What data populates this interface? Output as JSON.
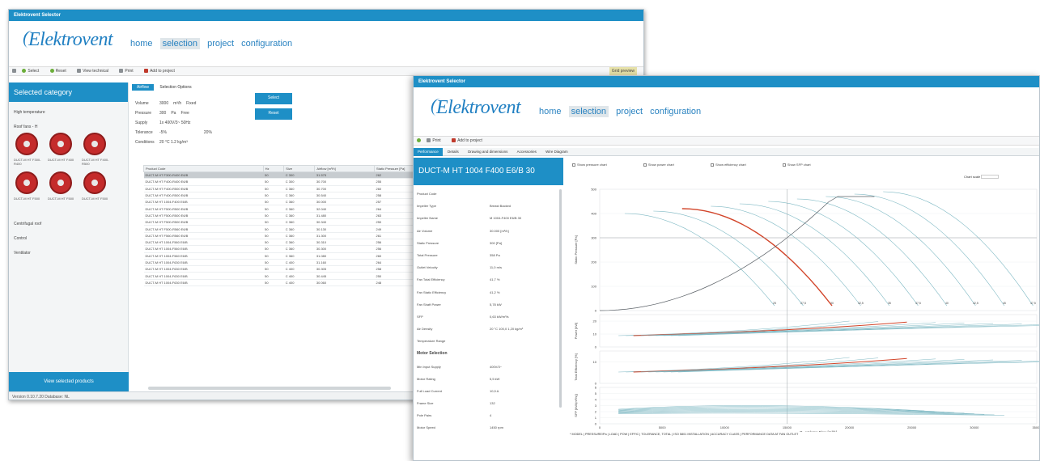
{
  "window1": {
    "title": "Elektrovent Selector",
    "logo": "Elektrovent",
    "nav": [
      "home",
      "selection",
      "project",
      "configuration"
    ],
    "toolbar": [
      "Select",
      "Reset",
      "View technical",
      "Print",
      "Add to project"
    ],
    "toolbar_right": "Grid preview",
    "sidebar_header": "Selected category",
    "categories": [
      "High temperature",
      "Roof fans - H",
      "Centrifugal roof",
      "Control",
      "Ventilator"
    ],
    "fans": [
      "DUCT-M HT F300-R400",
      "DUCT-M HT F400",
      "DUCT-M HT F400-R500",
      "DUCT-M HT F500",
      "DUCT-M HT F500",
      "DUCT-M HT F500"
    ],
    "sidebar_button": "View selected products",
    "tabs": [
      "Airflow",
      "Selection Options"
    ],
    "form": [
      {
        "label": "Volume",
        "value": "3000",
        "unit": "m³/h",
        "opt": "Fixed"
      },
      {
        "label": "Pressure",
        "value": "300",
        "unit": "Pa",
        "opt": "Free"
      },
      {
        "label": "Supply",
        "value": "1x 400V/3~ 50Hz",
        "unit": "",
        "opt": ""
      },
      {
        "label": "Tolerance",
        "value": "-5%",
        "unit": "",
        "opt": "20%"
      },
      {
        "label": "Conditions",
        "value": "20 °C  1.2 kg/m³",
        "unit": "",
        "opt": ""
      }
    ],
    "select_button": "Select",
    "reset_button": "Reset",
    "columns": [
      "Product Code",
      "Hz",
      "Size",
      "Airflow [m³/h]",
      "Static Pressure [Pa]",
      "Velocity [m/s]",
      "Power [kW]",
      "Total efficiency"
    ],
    "rows": [
      [
        "DUCT-M HT F300-R400 E6/B",
        "50",
        "C 300",
        "31.575",
        "262",
        "13.4",
        "0.63",
        "38.3"
      ],
      [
        "DUCT-M HT F400-R400 E6/B",
        "50",
        "C 300",
        "30.700",
        "255",
        "13.00",
        "0.61",
        "37.9"
      ],
      [
        "DUCT-M HT F400-R500 E6/B",
        "50",
        "C 360",
        "30.700",
        "260",
        "12.05",
        "4.86",
        "40.1"
      ],
      [
        "DUCT-M HT F400-R500 E6/B",
        "50",
        "C 360",
        "30.540",
        "258",
        "12.97",
        "4.82",
        "40.2"
      ],
      [
        "DUCT-M HT 1004-F400 E6/B",
        "50",
        "C 360",
        "30.000",
        "257",
        "12.53",
        "4.73",
        "40.4"
      ],
      [
        "DUCT-M HT F500-R500 E6/B",
        "50",
        "C 360",
        "32.040",
        "264",
        "13.54",
        "4.73",
        "38.9"
      ],
      [
        "DUCT-M HT F500-R500 E6/B",
        "50",
        "C 360",
        "31.480",
        "263",
        "13.11",
        "4.76",
        "39.1"
      ],
      [
        "DUCT-M HT F500-R500 E6/B",
        "50",
        "C 360",
        "30.340",
        "250",
        "12.98",
        "4.78",
        "39.3"
      ],
      [
        "DUCT-M HT F500-R560 E6/B",
        "50",
        "C 360",
        "30.130",
        "249",
        "12.81",
        "4.74",
        "39.6"
      ],
      [
        "DUCT-M HT F560-R560 E6/B",
        "50",
        "C 360",
        "31.300",
        "261",
        "13.35",
        "4.73",
        "40.0"
      ],
      [
        "DUCT-M HT 1004-F560 E6/B",
        "50",
        "C 360",
        "30.310",
        "256",
        "13.46",
        "4.37",
        "40.3"
      ],
      [
        "DUCT-M HT 1004-F560 E6/B",
        "50",
        "C 360",
        "30.300",
        "256",
        "12.79",
        "4.27",
        "40.6"
      ],
      [
        "DUCT-M HT 1004-F560 E6/B",
        "50",
        "C 360",
        "31.080",
        "260",
        "13.26",
        "4.30",
        "40.8"
      ],
      [
        "DUCT-M HT 1004-F630 E6/B",
        "50",
        "C 400",
        "31.160",
        "264",
        "13.28",
        "4.12",
        "41.0"
      ],
      [
        "DUCT-M HT 1004-F630 E6/B",
        "50",
        "C 400",
        "30.305",
        "258",
        "12.72",
        "4.07",
        "41.3"
      ],
      [
        "DUCT-M HT 1004-F630 E6/B",
        "50",
        "C 400",
        "30.445",
        "250",
        "12.82",
        "4.14",
        "41.5"
      ],
      [
        "DUCT-M HT 1004-F630 E6/B",
        "50",
        "C 400",
        "30.060",
        "248",
        "12.51",
        "4.10",
        "41.7"
      ]
    ],
    "status": "Version 0.10.7.20    Database: NL"
  },
  "window2": {
    "title": "Elektrovent Selector",
    "logo": "Elektrovent",
    "nav": [
      "home",
      "selection",
      "project",
      "configuration"
    ],
    "toolbar": [
      "Print",
      "Add to project"
    ],
    "tabs": [
      "Performance",
      "Details",
      "Drawing and dimensions",
      "Accessories",
      "Wire Diagram"
    ],
    "product_title": "DUCT-M HT 1004 F400 E6/B 30",
    "checkboxes": [
      "Show pressure chart",
      "Show power chart",
      "Show efficiency chart",
      "Show SFP chart"
    ],
    "chart_scale_label": "Chart scale",
    "properties": [
      [
        "Product Code",
        ""
      ],
      [
        "Impeller Type",
        "Breast Backed"
      ],
      [
        "Impeller Name",
        "M 1004-F400 E6/B 30"
      ],
      [
        "Air Volume",
        "30.000 [m³/h]"
      ],
      [
        "Static Pressure",
        "300 [Pa]"
      ],
      [
        "Total Pressure",
        "358 Pa"
      ],
      [
        "Outlet Velocity",
        "11,0 m/s"
      ],
      [
        "Fan Total Efficiency",
        "41,7 %"
      ],
      [
        "Fan Static Efficiency",
        "41,2 %"
      ],
      [
        "Fan Shaft Power",
        "5,78 kW"
      ],
      [
        "SFP",
        "0,63 kW/m³/s"
      ],
      [
        "Air Density",
        "20 °C  100,0  1,20 kg/m³"
      ],
      [
        "Temperature Range",
        ""
      ]
    ],
    "motor_section": "Motor Selection",
    "motor_properties": [
      [
        "Min Input Supply",
        "400V/3~"
      ],
      [
        "Motor Rating",
        "5,5 kW"
      ],
      [
        "Full Load Current",
        "10,9 A"
      ],
      [
        "Frame Size",
        "132"
      ],
      [
        "Pole Pairs",
        "4"
      ],
      [
        "Motor Speed",
        "1450 rpm"
      ]
    ],
    "footnote": "* MODEL | PRESSURE/Pa | LOAD | POW | EFFIC | TOLERANCE, TOTAL | ISO 5801 INSTALLATION | ACCURACY CLASS | PERFORMANCE DATA AT FAN OUTLET",
    "status": "Version 0.10.7.20    Database: NL"
  },
  "chart_data": {
    "type": "line",
    "xlabel": "Q - Volume Flow [m³/h]",
    "x_ticks": [
      0,
      5000,
      10000,
      15000,
      20000,
      25000,
      30000,
      35000
    ],
    "panels": [
      {
        "ylabel": "Static Pressure [Pa]",
        "y_ticks": [
          0,
          100,
          200,
          300,
          400,
          500
        ]
      },
      {
        "ylabel": "Power [kW]",
        "y_ticks": [
          0,
          10,
          20
        ]
      },
      {
        "ylabel": "Total Efficiency [%]",
        "y_ticks": [
          0,
          10
        ]
      },
      {
        "ylabel": "SFP [kW/(m³/s)]",
        "y_ticks": [
          0,
          1,
          2,
          3,
          4,
          5,
          6
        ]
      }
    ],
    "operating_point": {
      "x": 15000,
      "y": 300
    },
    "speed_labels": [
      "25",
      "27,5",
      "30",
      "32,5",
      "35",
      "37,5",
      "40",
      "42,5",
      "45",
      "47,5"
    ],
    "colors": {
      "selected": "#d2452a",
      "curves": "#7fb9c4",
      "system": "#5a6066",
      "accent": "#1e8fc6"
    }
  }
}
